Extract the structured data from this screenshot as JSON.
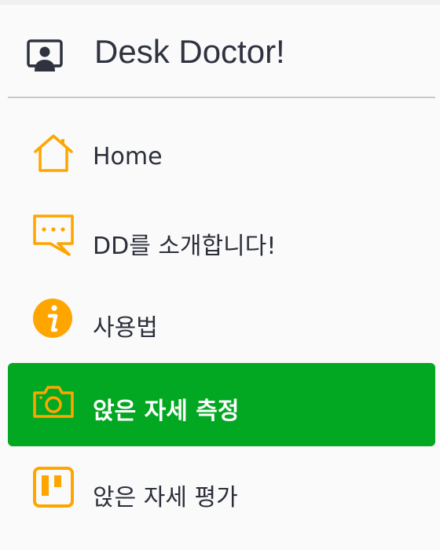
{
  "app": {
    "title": "Desk Doctor!",
    "logo_icon": "user-monitor-icon"
  },
  "colors": {
    "accent_icon": "#ffa500",
    "active_bg": "#02a821",
    "text": "#2b2f3a",
    "divider": "#c8c8c8"
  },
  "menu": {
    "items": [
      {
        "label": "Home",
        "icon": "home-icon",
        "active": false
      },
      {
        "label": "DD를 소개합니다!",
        "icon": "chat-bubble-icon",
        "active": false
      },
      {
        "label": "사용법",
        "icon": "info-icon",
        "active": false
      },
      {
        "label": "앉은 자세 측정",
        "icon": "camera-icon",
        "active": true
      },
      {
        "label": "앉은 자세 평가",
        "icon": "board-icon",
        "active": false
      }
    ]
  }
}
